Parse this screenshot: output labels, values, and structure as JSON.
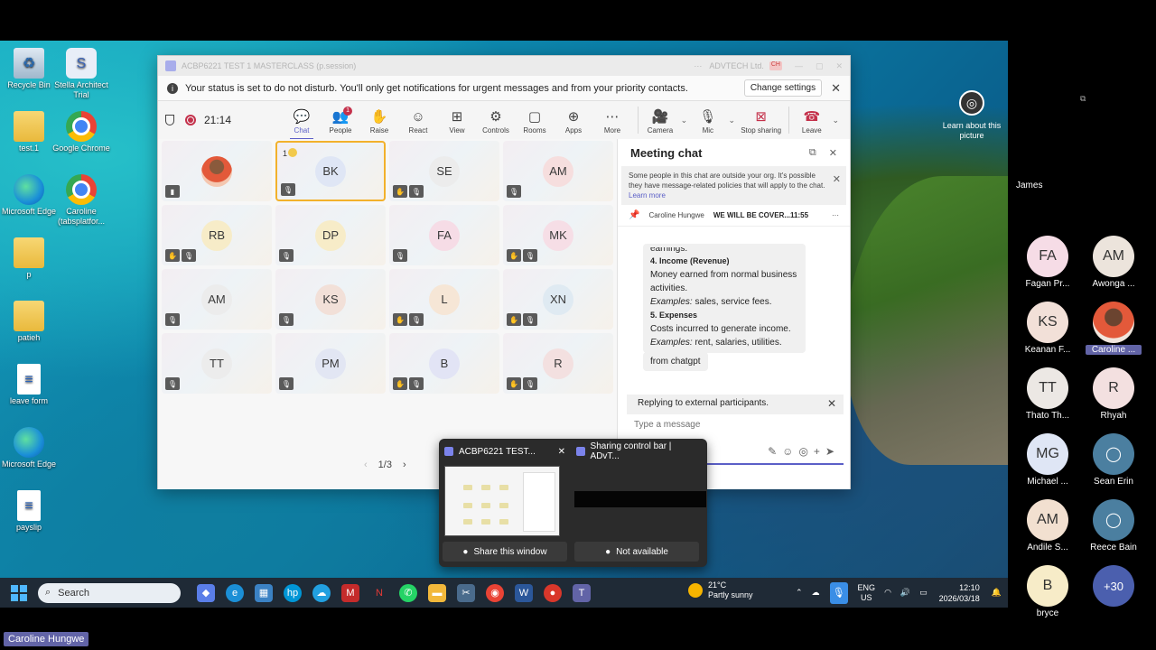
{
  "desktop": {
    "icons": [
      {
        "label": "Recycle Bin",
        "icon": "recycle-bin-icon"
      },
      {
        "label": "Stella Architect Trial",
        "icon": "stella-icon"
      },
      {
        "label": "test.1",
        "icon": "folder-icon"
      },
      {
        "label": "Google Chrome",
        "icon": "chrome-icon"
      },
      {
        "label": "Microsoft Edge",
        "icon": "edge-icon"
      },
      {
        "label": "Caroline (tabsplatfor...",
        "icon": "chrome-profile-icon"
      },
      {
        "label": "p",
        "icon": "folder-icon"
      },
      {
        "label": "patieh",
        "icon": "folder-icon"
      },
      {
        "label": "leave form",
        "icon": "document-icon"
      },
      {
        "label": "Microsoft Edge",
        "icon": "edge-icon"
      },
      {
        "label": "payslip",
        "icon": "document-icon"
      }
    ],
    "learn": "Learn about this picture"
  },
  "teams": {
    "title": "ACBP6221 TEST 1 MASTERCLASS (p.session)",
    "org": "ADVTECH Ltd.",
    "org_avatar": "CH",
    "banner": {
      "text": "Your status is set to do not disturb. You'll only get notifications for urgent messages and from your priority contacts.",
      "button": "Change settings"
    },
    "timer": "21:14",
    "toolbar": [
      {
        "label": "Chat",
        "glyph": "💬",
        "active": true
      },
      {
        "label": "People",
        "glyph": "👥",
        "badge": "1"
      },
      {
        "label": "Raise",
        "glyph": "✋"
      },
      {
        "label": "React",
        "glyph": "☺"
      },
      {
        "label": "View",
        "glyph": "⊞"
      },
      {
        "label": "Controls",
        "glyph": "⚙"
      },
      {
        "label": "Rooms",
        "glyph": "▢"
      },
      {
        "label": "Apps",
        "glyph": "⊕"
      },
      {
        "label": "More",
        "glyph": "⋯"
      }
    ],
    "controls": {
      "camera": "Camera",
      "mic": "Mic",
      "stop_sharing": "Stop sharing",
      "leave": "Leave"
    },
    "tiles": [
      {
        "initials": "",
        "photo": true,
        "color": "#f2f2f2",
        "status": [
          "▮"
        ]
      },
      {
        "initials": "BK",
        "color": "#dfe6f5",
        "speaking": true,
        "hand": "1",
        "status": [
          "🎙"
        ]
      },
      {
        "initials": "SE",
        "color": "#ececec",
        "status": [
          "✋",
          "🎙"
        ]
      },
      {
        "initials": "AM",
        "color": "#f6dede",
        "status": [
          "🎙"
        ]
      },
      {
        "initials": "RB",
        "color": "#f7ecc8",
        "status": [
          "✋",
          "🎙"
        ]
      },
      {
        "initials": "DP",
        "color": "#f7ecc8",
        "status": [
          "🎙"
        ]
      },
      {
        "initials": "FA",
        "color": "#f6dce6",
        "status": [
          "🎙"
        ]
      },
      {
        "initials": "MK",
        "color": "#f6dee6",
        "status": [
          "✋",
          "🎙"
        ]
      },
      {
        "initials": "AM",
        "color": "#ececec",
        "status": [
          "🎙"
        ]
      },
      {
        "initials": "KS",
        "color": "#f2e0d8",
        "status": [
          "🎙"
        ]
      },
      {
        "initials": "L",
        "color": "#f6e6d6",
        "status": [
          "✋",
          "🎙"
        ]
      },
      {
        "initials": "XN",
        "color": "#dfeaf2",
        "status": [
          "✋",
          "🎙"
        ]
      },
      {
        "initials": "TT",
        "color": "#ececec",
        "status": [
          "🎙"
        ]
      },
      {
        "initials": "PM",
        "color": "#e2e6f3",
        "status": [
          "🎙"
        ]
      },
      {
        "initials": "B",
        "color": "#e2e4f5",
        "status": [
          "✋",
          "🎙"
        ]
      },
      {
        "initials": "R",
        "color": "#f3e0e0",
        "status": [
          "✋",
          "🎙"
        ]
      }
    ],
    "pager": "1/3",
    "chat": {
      "title": "Meeting chat",
      "external_notice": "Some people in this chat are outside your org. It's possible they have message-related policies that will apply to the chat.",
      "learn_more": "Learn more",
      "pinned_author": "Caroline Hungwe",
      "pinned_text": "WE WILL BE COVER...11:55",
      "message": {
        "lead": "earnings.",
        "h4": "4. Income (Revenue)",
        "p4": "Money earned from normal business activities.",
        "ex4_label": "Examples:",
        "ex4": " sales, service fees.",
        "h5": "5. Expenses",
        "p5": "Costs incurred to generate income.",
        "ex5_label": "Examples:",
        "ex5": " rent, salaries, utilities."
      },
      "message2": "from chatgpt",
      "replying": "Replying to external participants.",
      "placeholder": "Type a message"
    }
  },
  "thumbnails": [
    {
      "title": "ACBP6221 TEST...",
      "action": "Share this window"
    },
    {
      "title": "Sharing control bar | ADvT...",
      "action": "Not available"
    }
  ],
  "taskbar": {
    "search": "Search",
    "weather_temp": "21°C",
    "weather_desc": "Partly sunny",
    "lang1": "ENG",
    "lang2": "US",
    "time": "12:10",
    "date": "2026/03/18"
  },
  "strip": {
    "top_name": "James",
    "people": [
      {
        "initials": "FA",
        "label": "Fagan Pr...",
        "color": "#f6dce6"
      },
      {
        "initials": "AM",
        "label": "Awonga ...",
        "color": "#ece4dc"
      },
      {
        "initials": "KS",
        "label": "Keanan F...",
        "color": "#f2e0d8"
      },
      {
        "initials": "",
        "label": "Caroline ...",
        "photo": true,
        "highlight": true
      },
      {
        "initials": "TT",
        "label": "Thato Th...",
        "color": "#ece8e4"
      },
      {
        "initials": "R",
        "label": "Rhyah",
        "color": "#f3e0e0"
      },
      {
        "initials": "MG",
        "label": "Michael ...",
        "color": "#dfe6f5"
      },
      {
        "initials": "",
        "label": "Sean Erin",
        "user": true
      },
      {
        "initials": "AM",
        "label": "Andile S...",
        "color": "#f2e0d0"
      },
      {
        "initials": "",
        "label": "Reece Bain",
        "user": true
      },
      {
        "initials": "B",
        "label": "bryce",
        "color": "#f7ecc8"
      },
      {
        "initials": "+30",
        "label": "",
        "more": true
      }
    ]
  },
  "presenter": "Caroline Hungwe"
}
